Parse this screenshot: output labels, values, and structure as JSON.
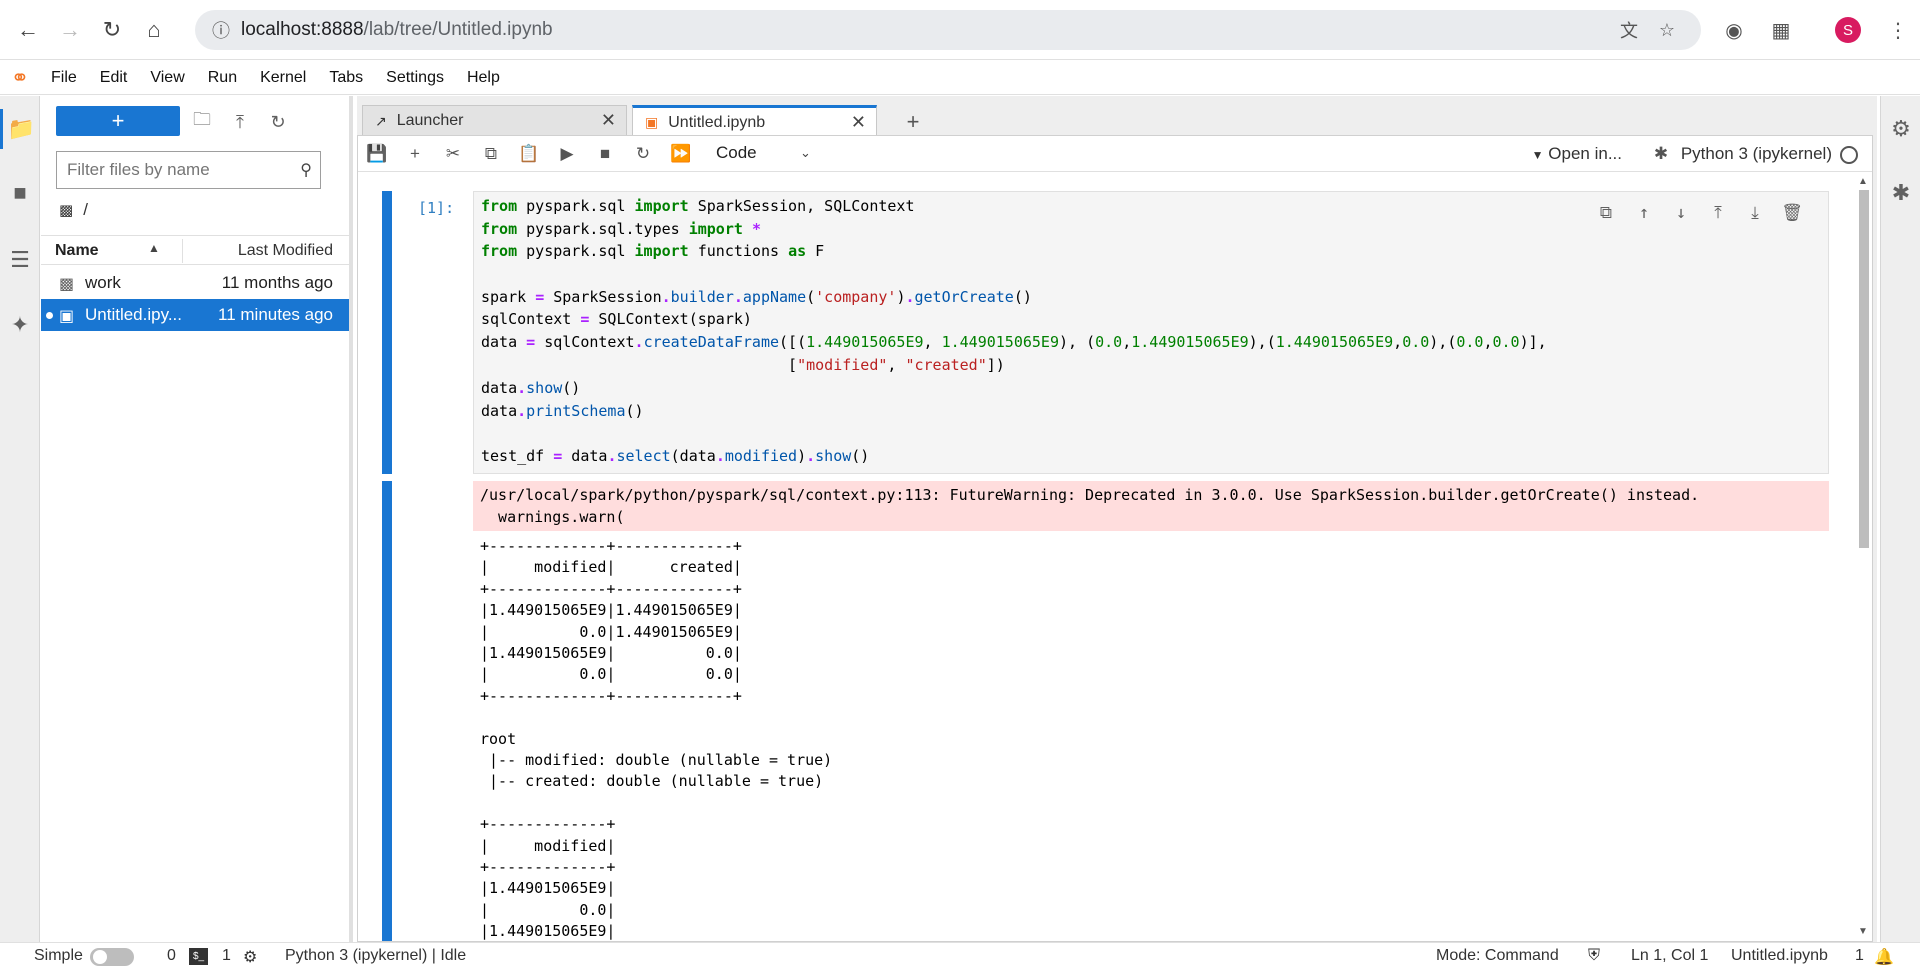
{
  "browser": {
    "url_host": "localhost:8888",
    "url_path": "/lab/tree/Untitled.ipynb",
    "profile_initial": "S"
  },
  "menu": [
    "File",
    "Edit",
    "View",
    "Run",
    "Kernel",
    "Tabs",
    "Settings",
    "Help"
  ],
  "filebrowser": {
    "filter_placeholder": "Filter files by name",
    "breadcrumb": "/",
    "col_name": "Name",
    "col_modified": "Last Modified",
    "files": [
      {
        "name": "work",
        "modified": "11 months ago",
        "type": "folder"
      },
      {
        "name": "Untitled.ipy...",
        "modified": "11 minutes ago",
        "type": "notebook"
      }
    ]
  },
  "tabs": [
    {
      "label": "Launcher"
    },
    {
      "label": "Untitled.ipynb"
    }
  ],
  "toolbar": {
    "cell_type": "Code",
    "open_in": "Open in...",
    "kernel": "Python 3 (ipykernel)"
  },
  "cell": {
    "prompt": "[1]:",
    "code": [
      "from pyspark.sql import SparkSession, SQLContext",
      "from pyspark.sql.types import *",
      "from pyspark.sql import functions as F",
      "",
      "spark = SparkSession.builder.appName('company').getOrCreate()",
      "sqlContext = SQLContext(spark)",
      "data = sqlContext.createDataFrame([(1.449015065E9, 1.449015065E9), (0.0,1.449015065E9),(1.449015065E9,0.0),(0.0,0.0)],",
      "                                  [\"modified\", \"created\"])",
      "data.show()",
      "data.printSchema()",
      "",
      "test_df = data.select(data.modified).show()"
    ],
    "stderr": [
      "/usr/local/spark/python/pyspark/sql/context.py:113: FutureWarning: Deprecated in 3.0.0. Use SparkSession.builder.getOrCreate() instead.",
      "  warnings.warn("
    ],
    "stdout": [
      "+-------------+-------------+",
      "|     modified|      created|",
      "+-------------+-------------+",
      "|1.449015065E9|1.449015065E9|",
      "|          0.0|1.449015065E9|",
      "|1.449015065E9|          0.0|",
      "|          0.0|          0.0|",
      "+-------------+-------------+",
      "",
      "root",
      " |-- modified: double (nullable = true)",
      " |-- created: double (nullable = true)",
      "",
      "+-------------+",
      "|     modified|",
      "+-------------+",
      "|1.449015065E9|",
      "|          0.0|",
      "|1.449015065E9|"
    ]
  },
  "statusbar": {
    "mode_label": "Simple",
    "terminals": "0",
    "kernels": "1",
    "kernel_status": "Python 3 (ipykernel) | Idle",
    "mode": "Mode: Command",
    "position": "Ln 1, Col 1",
    "filename": "Untitled.ipynb",
    "notifications": "1"
  },
  "colors": {
    "accent": "#1976d2",
    "stderr_bg": "#ffdddd",
    "jupyter_orange": "#f37726",
    "avatar": "#d81b60"
  }
}
